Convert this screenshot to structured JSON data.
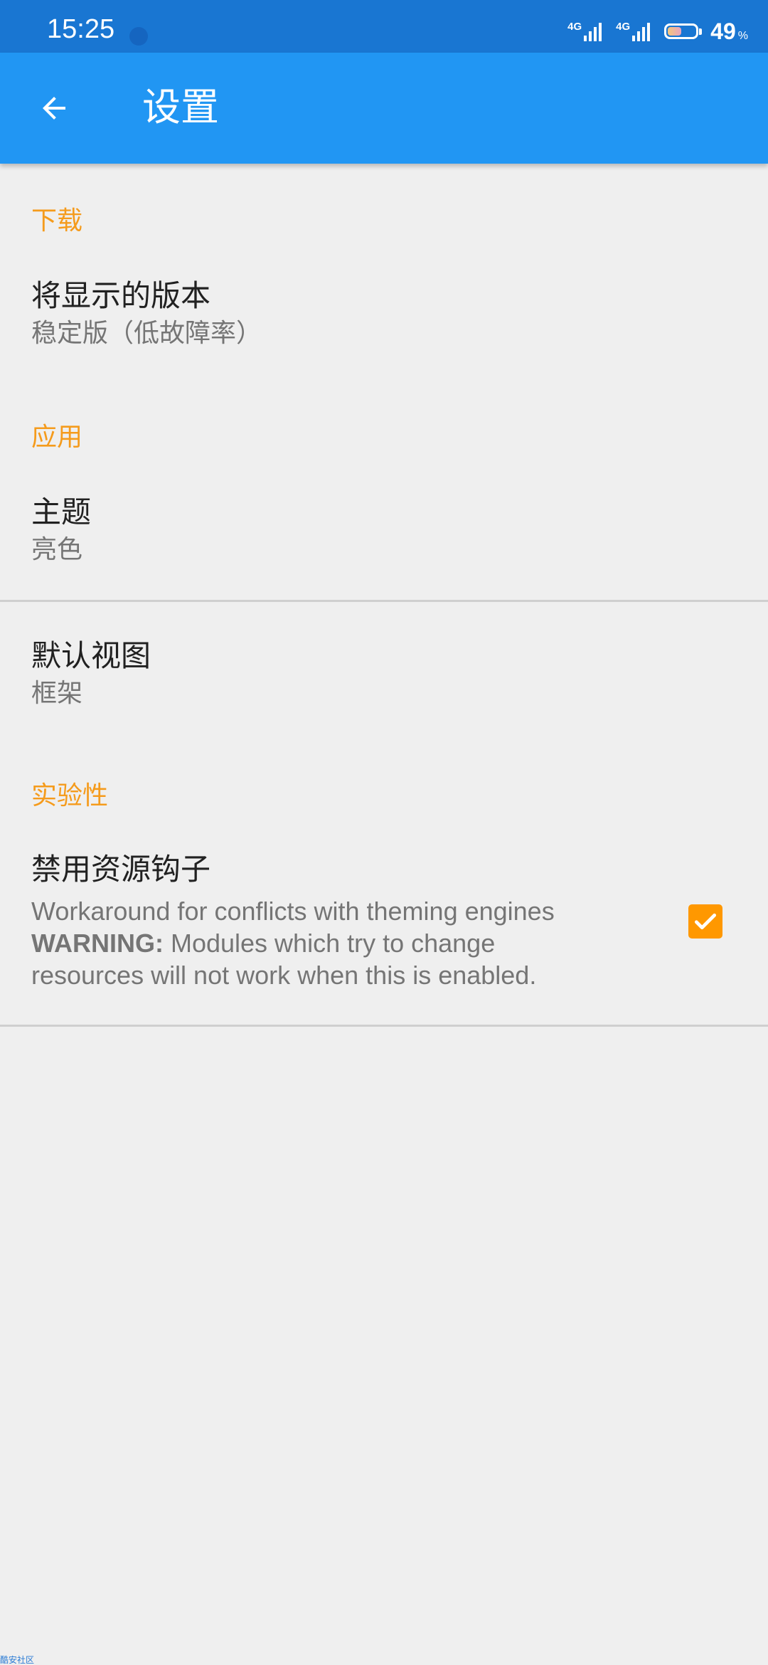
{
  "status_bar": {
    "time": "15:25",
    "network_1": "4G",
    "network_2": "4G",
    "battery_percent": "49",
    "battery_unit": "%",
    "battery_level": 0.49
  },
  "toolbar": {
    "title": "设置",
    "back_icon": "arrow-back-icon",
    "background": "#2196f3"
  },
  "sections": {
    "download": {
      "header": "下载",
      "version_title": "将显示的版本",
      "version_summary": "稳定版（低故障率）"
    },
    "app": {
      "header": "应用",
      "theme_title": "主题",
      "theme_summary": "亮色",
      "default_view_title": "默认视图",
      "default_view_summary": "框架"
    },
    "experimental": {
      "header": "实验性",
      "disable_hooks_title": "禁用资源钩子",
      "disable_hooks_line1": "Workaround for conflicts with theming engines",
      "disable_hooks_warning_label": "WARNING:",
      "disable_hooks_line2_rest": " Modules which try to change",
      "disable_hooks_line3": "resources will not work when this is enabled.",
      "disable_hooks_checked": true
    }
  },
  "accent_color": "#f59b1c",
  "checkbox_color": "#ff9800",
  "footer": {
    "watermark": "酷安社区"
  }
}
